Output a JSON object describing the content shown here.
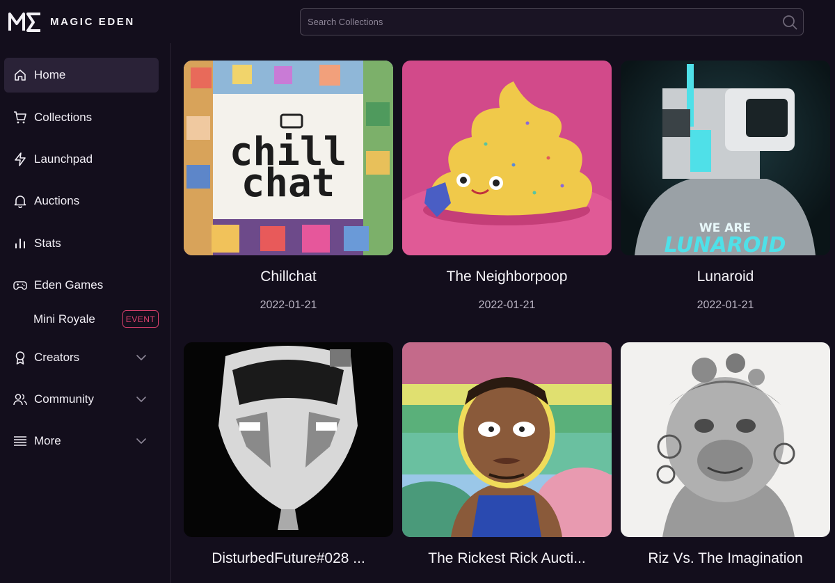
{
  "header": {
    "logo_text": "MAGIC EDEN",
    "search_placeholder": "Search Collections"
  },
  "sidebar": {
    "items": [
      {
        "label": "Home",
        "icon": "home-icon",
        "active": true
      },
      {
        "label": "Collections",
        "icon": "cart-icon"
      },
      {
        "label": "Launchpad",
        "icon": "lightning-icon"
      },
      {
        "label": "Auctions",
        "icon": "bell-icon"
      },
      {
        "label": "Stats",
        "icon": "bar-chart-icon"
      },
      {
        "label": "Eden Games",
        "icon": "gamepad-icon"
      },
      {
        "label": "Creators",
        "icon": "award-icon",
        "expandable": true
      },
      {
        "label": "Community",
        "icon": "users-icon",
        "expandable": true
      },
      {
        "label": "More",
        "icon": "menu-icon",
        "expandable": true
      }
    ],
    "sub_item": {
      "label": "Mini Royale",
      "badge": "EVENT"
    }
  },
  "cards": [
    {
      "title": "Chillchat",
      "date": "2022-01-21",
      "art_text": "chill chat"
    },
    {
      "title": "The Neighborpoop",
      "date": "2022-01-21"
    },
    {
      "title": "Lunaroid",
      "date": "2022-01-21",
      "art_text_1": "WE ARE",
      "art_text_2": "LUNAROID"
    },
    {
      "title": "DisturbedFuture#028 ...",
      "date": ""
    },
    {
      "title": "The Rickest Rick Aucti...",
      "date": ""
    },
    {
      "title": "Riz Vs. The Imagination",
      "date": ""
    }
  ],
  "colors": {
    "background": "#130e1c",
    "accent_event": "#e0426f",
    "active_nav": "#2a2237"
  }
}
